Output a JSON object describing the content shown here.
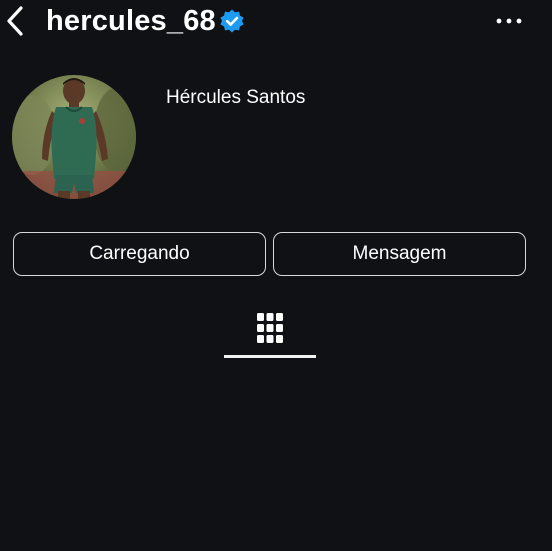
{
  "header": {
    "username": "hercules_68",
    "back_icon": "chevron-left-icon",
    "verified_icon": "verified-badge-icon",
    "more_icon": "more-horizontal-icon"
  },
  "profile": {
    "full_name": "Hércules Santos",
    "avatar_icon": "profile-photo"
  },
  "actions": {
    "follow_label": "Carregando",
    "message_label": "Mensagem"
  },
  "tabs": {
    "active": "grid-icon"
  },
  "colors": {
    "background": "#0f1115",
    "text": "#ffffff",
    "verified": "#1d9bf0",
    "button_border": "#d9d9d9"
  }
}
